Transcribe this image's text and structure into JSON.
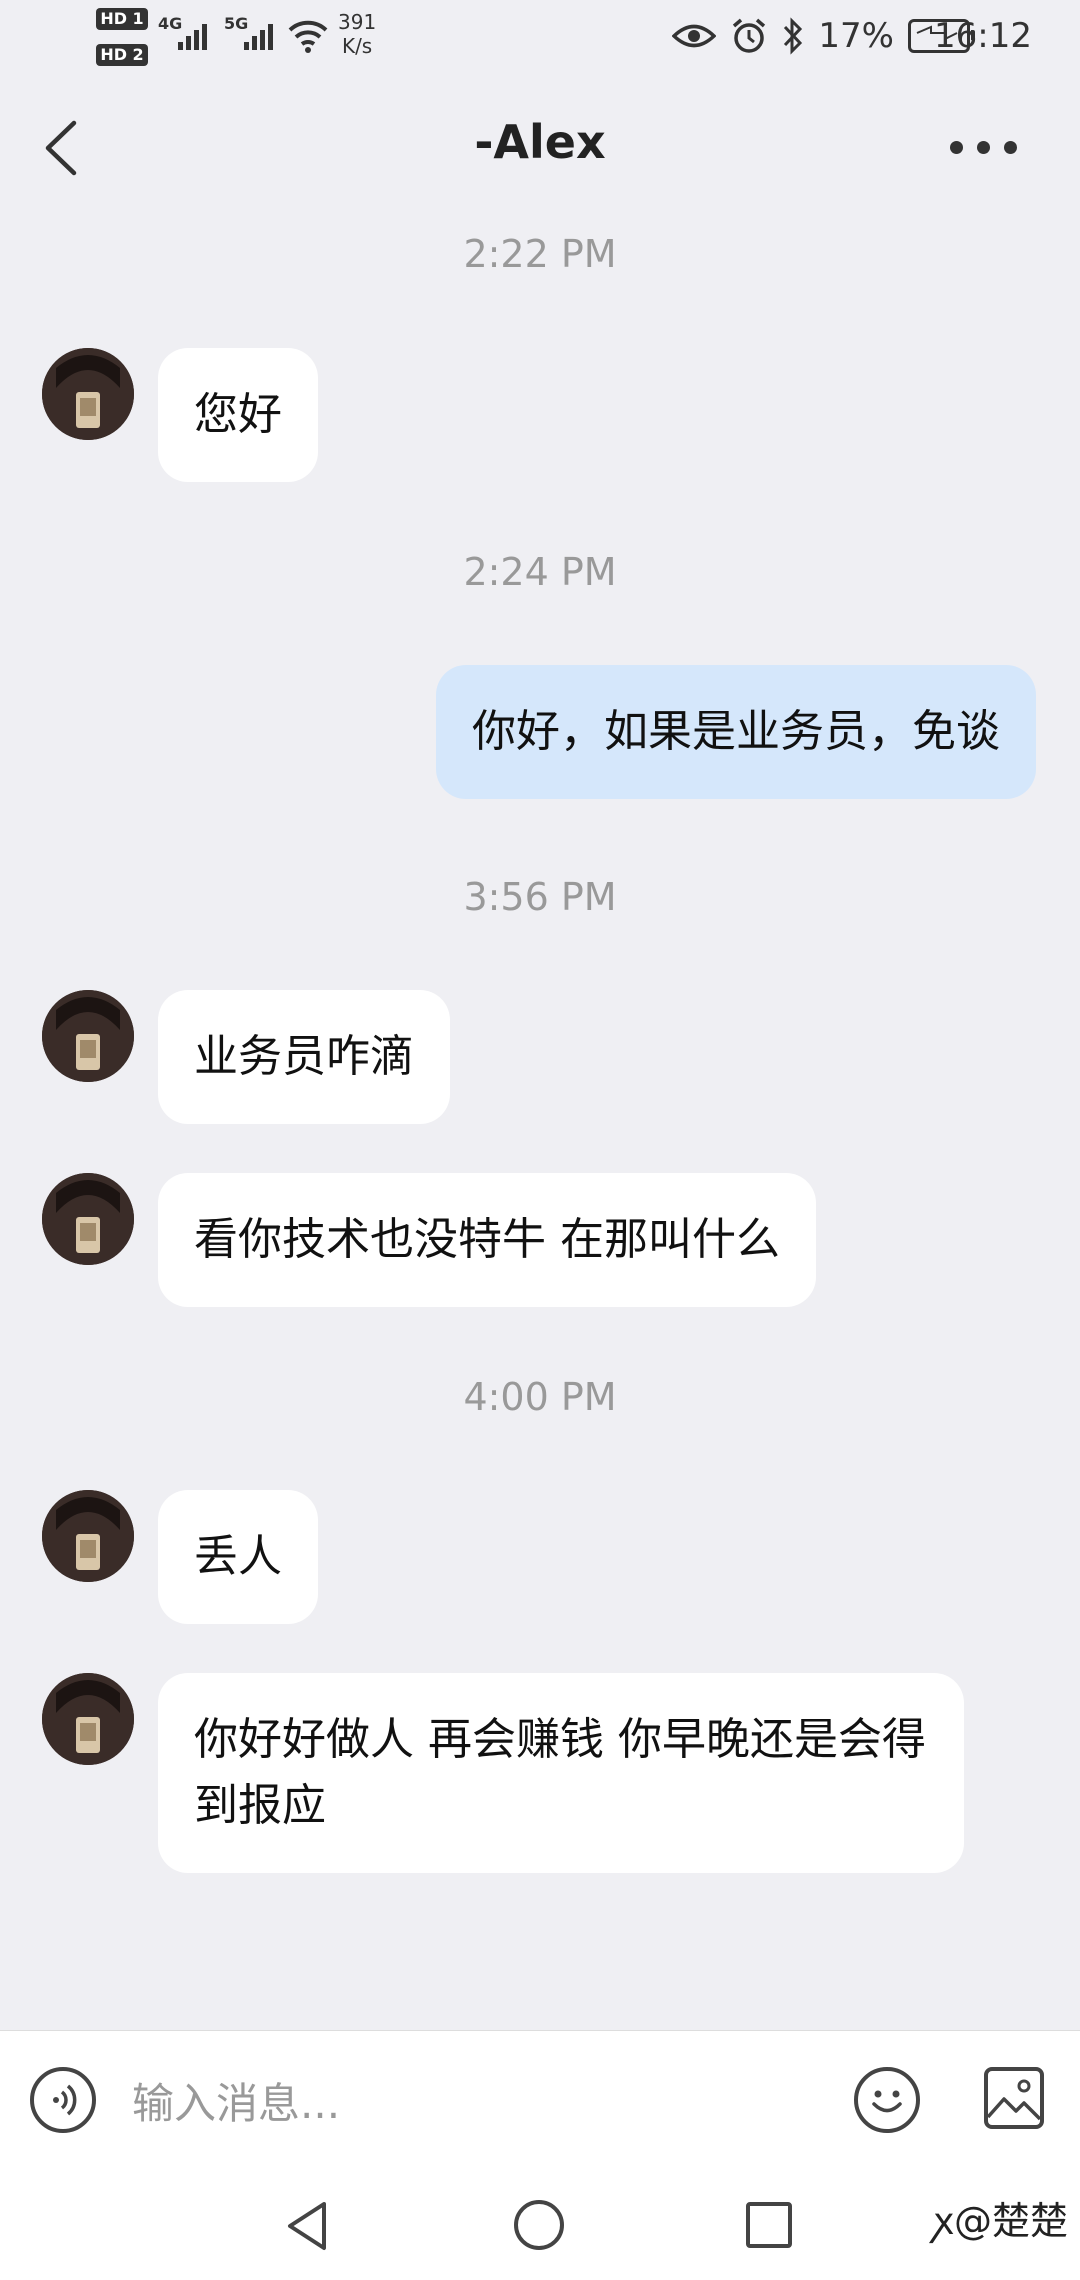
{
  "status_bar": {
    "sim1_badge": "HD 1",
    "sim2_badge": "HD 2",
    "net1": "4G",
    "net2": "5G",
    "speed_value": "391",
    "speed_unit": "K/s",
    "battery": "17%",
    "time": "16:12"
  },
  "header": {
    "title": "-Alex"
  },
  "messages": [
    {
      "time": "2:22 PM",
      "from": "other",
      "text": "您好"
    },
    {
      "time": "2:24 PM",
      "from": "self",
      "text": "你好，如果是业务员，免谈"
    },
    {
      "time": "3:56 PM",
      "from": "other",
      "text": "业务员咋滴"
    },
    {
      "from": "other",
      "text": "看你技术也没特牛 在那叫什么"
    },
    {
      "time": "4:00 PM",
      "from": "other",
      "text": "丢人"
    },
    {
      "from": "other",
      "text": "你好好做人 再会赚钱 你早晚还是会得到报应"
    }
  ],
  "input": {
    "placeholder": "输入消息..."
  },
  "watermark": "@楚楚",
  "colors": {
    "background": "#efeff3",
    "bubble_other": "#ffffff",
    "bubble_self": "#d5e7fb",
    "timestamp": "#999999"
  }
}
